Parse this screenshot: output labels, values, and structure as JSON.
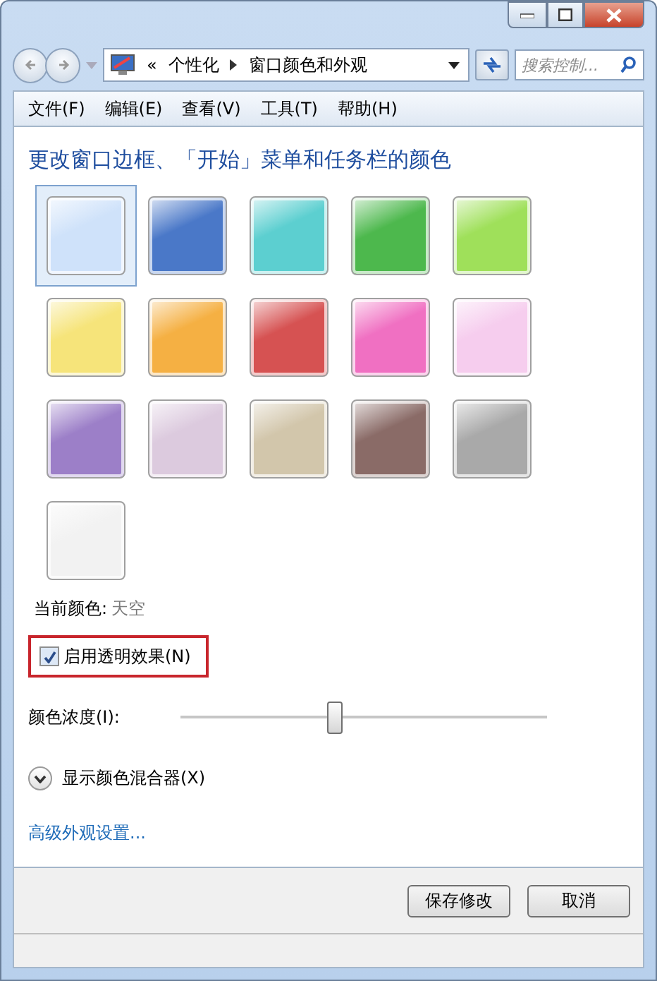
{
  "address": {
    "crumbs": [
      "«",
      "个性化",
      "窗口颜色和外观"
    ]
  },
  "search": {
    "placeholder": "搜索控制..."
  },
  "menu": [
    "文件(F)",
    "编辑(E)",
    "查看(V)",
    "工具(T)",
    "帮助(H)"
  ],
  "heading": "更改窗口边框、「开始」菜单和任务栏的颜色",
  "swatches": [
    {
      "color": "#cfe2fa",
      "selected": true
    },
    {
      "color": "#4a78c8",
      "selected": false
    },
    {
      "color": "#5ccfd0",
      "selected": false
    },
    {
      "color": "#4db84d",
      "selected": false
    },
    {
      "color": "#9fe05a",
      "selected": false
    },
    {
      "color": "#f6e47a",
      "selected": false
    },
    {
      "color": "#f5b043",
      "selected": false
    },
    {
      "color": "#d65252",
      "selected": false
    },
    {
      "color": "#f070c2",
      "selected": false
    },
    {
      "color": "#f6cdee",
      "selected": false
    },
    {
      "color": "#9c7fc8",
      "selected": false
    },
    {
      "color": "#dccade",
      "selected": false
    },
    {
      "color": "#d2c6ab",
      "selected": false
    },
    {
      "color": "#8a6b67",
      "selected": false
    },
    {
      "color": "#a9a9a9",
      "selected": false
    },
    {
      "color": "#f2f2f2",
      "selected": false
    }
  ],
  "current_color": {
    "label": "当前颜色:",
    "value": "天空"
  },
  "transparency": {
    "label": "启用透明效果(N)",
    "checked": true
  },
  "intensity": {
    "label": "颜色浓度(I):",
    "level": 0.42
  },
  "mixer": {
    "label": "显示颜色混合器(X)",
    "expanded": false
  },
  "advanced_link": "高级外观设置...",
  "buttons": [
    "保存修改",
    "取消"
  ]
}
